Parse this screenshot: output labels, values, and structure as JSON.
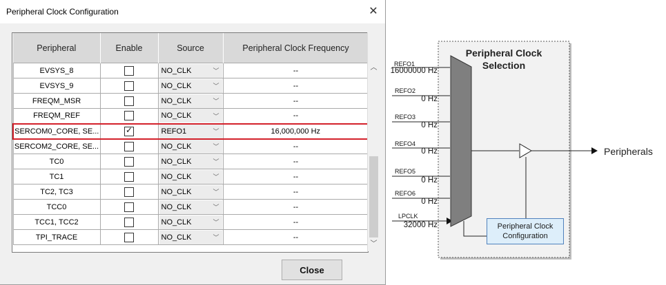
{
  "dialog": {
    "title": "Peripheral Clock Configuration",
    "close_x": "✕",
    "close_button": "Close",
    "columns": [
      "Peripheral",
      "Enable",
      "Source",
      "Peripheral Clock Frequency"
    ],
    "rows": [
      {
        "peripheral": "EVSYS_8",
        "enabled": false,
        "source": "NO_CLK",
        "frequency": "--"
      },
      {
        "peripheral": "EVSYS_9",
        "enabled": false,
        "source": "NO_CLK",
        "frequency": "--"
      },
      {
        "peripheral": "FREQM_MSR",
        "enabled": false,
        "source": "NO_CLK",
        "frequency": "--"
      },
      {
        "peripheral": "FREQM_REF",
        "enabled": false,
        "source": "NO_CLK",
        "frequency": "--"
      },
      {
        "peripheral": "SERCOM0_CORE, SE...",
        "enabled": true,
        "source": "REFO1",
        "frequency": "16,000,000 Hz",
        "highlighted": true
      },
      {
        "peripheral": "SERCOM2_CORE, SE...",
        "enabled": false,
        "source": "NO_CLK",
        "frequency": "--"
      },
      {
        "peripheral": "TC0",
        "enabled": false,
        "source": "NO_CLK",
        "frequency": "--"
      },
      {
        "peripheral": "TC1",
        "enabled": false,
        "source": "NO_CLK",
        "frequency": "--"
      },
      {
        "peripheral": "TC2, TC3",
        "enabled": false,
        "source": "NO_CLK",
        "frequency": "--"
      },
      {
        "peripheral": "TCC0",
        "enabled": false,
        "source": "NO_CLK",
        "frequency": "--"
      },
      {
        "peripheral": "TCC1, TCC2",
        "enabled": false,
        "source": "NO_CLK",
        "frequency": "--"
      },
      {
        "peripheral": "TPI_TRACE",
        "enabled": false,
        "source": "NO_CLK",
        "frequency": "--"
      }
    ],
    "highlight_color": "#d3202a"
  },
  "diagram": {
    "title_line1": "Peripheral Clock",
    "title_line2": "Selection",
    "inputs": [
      {
        "name": "REFO1",
        "value": "16000000 Hz"
      },
      {
        "name": "REFO2",
        "value": "0 Hz"
      },
      {
        "name": "REFO3",
        "value": "0 Hz"
      },
      {
        "name": "REFO4",
        "value": "0 Hz"
      },
      {
        "name": "REFO5",
        "value": "0 Hz"
      },
      {
        "name": "REFO6",
        "value": "0 Hz"
      },
      {
        "name": "LPCLK",
        "value": "32000 Hz"
      }
    ],
    "output_label": "Peripherals",
    "config_box_line1": "Peripheral Clock",
    "config_box_line2": "Configuration",
    "mux_color": "#7f7f7f",
    "config_box_color": "#ddeefa"
  }
}
